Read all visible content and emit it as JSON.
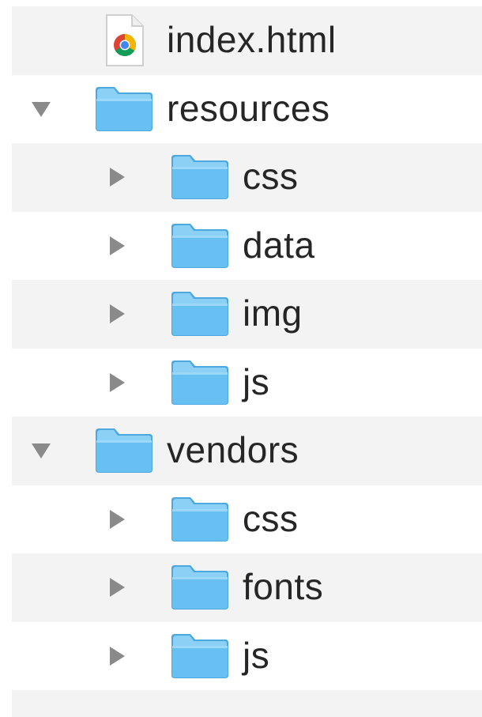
{
  "tree": [
    {
      "label": "index.html",
      "type": "file",
      "icon": "chrome-html-file-icon",
      "depth": 0,
      "expanded": null
    },
    {
      "label": "resources",
      "type": "folder",
      "icon": "folder-icon",
      "depth": 0,
      "expanded": true
    },
    {
      "label": "css",
      "type": "folder",
      "icon": "folder-icon",
      "depth": 1,
      "expanded": false
    },
    {
      "label": "data",
      "type": "folder",
      "icon": "folder-icon",
      "depth": 1,
      "expanded": false
    },
    {
      "label": "img",
      "type": "folder",
      "icon": "folder-icon",
      "depth": 1,
      "expanded": false
    },
    {
      "label": "js",
      "type": "folder",
      "icon": "folder-icon",
      "depth": 1,
      "expanded": false
    },
    {
      "label": "vendors",
      "type": "folder",
      "icon": "folder-icon",
      "depth": 0,
      "expanded": true
    },
    {
      "label": "css",
      "type": "folder",
      "icon": "folder-icon",
      "depth": 1,
      "expanded": false
    },
    {
      "label": "fonts",
      "type": "folder",
      "icon": "folder-icon",
      "depth": 1,
      "expanded": false
    },
    {
      "label": "js",
      "type": "folder",
      "icon": "folder-icon",
      "depth": 1,
      "expanded": false
    }
  ],
  "colors": {
    "folder_fill": "#68c0f2",
    "folder_tab": "#8dd0f6",
    "folder_edge": "#4ea8e0",
    "disclosure": "#8a8a8a",
    "stripe": "#f3f3f3",
    "text": "#262626"
  }
}
